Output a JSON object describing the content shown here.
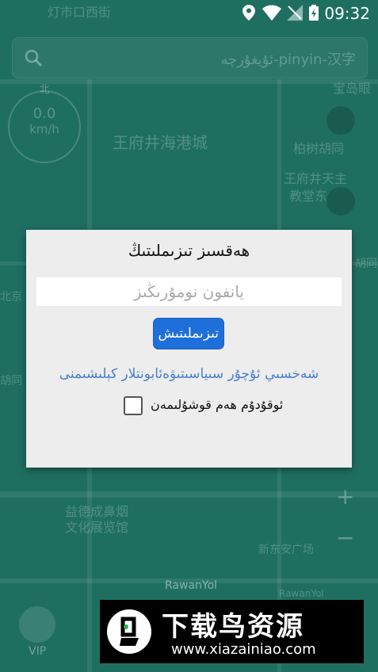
{
  "status_bar": {
    "time": "09:32"
  },
  "map": {
    "search_placeholder": "ئۇيغۇرچە-pinyin-汉字",
    "speed_value": "0.0",
    "speed_unit": "km/h",
    "compass": "北",
    "labels": [
      "灯市口西街",
      "王府井海港城",
      "宝岛眼",
      "柏树胡同",
      "王府井天主",
      "教堂东",
      "北京",
      "胡同",
      "胡同",
      "益德成鼻烟",
      "文化展览馆",
      "新东安广场",
      "RawanYol",
      "RawanYol"
    ],
    "zoom_in": "+",
    "zoom_out": "−"
  },
  "dialog": {
    "title": "ھەقسىز تىزىملىتىڭ",
    "phone_placeholder": "يانفون نومۇرىڭىز",
    "login_button": "تىزىملىتىش",
    "policy_link": "شەخسىي ئۇچۇر سىياسىتىۋەئابونتلار كېلىشىمنى",
    "agree_label": "ئوقۇدۇم ھەم قوشۇلىمەن"
  },
  "bottom": {
    "vip_label": "VIP"
  },
  "watermark": {
    "title": "下载鸟资源",
    "url": "www.xiazainiao.com"
  }
}
